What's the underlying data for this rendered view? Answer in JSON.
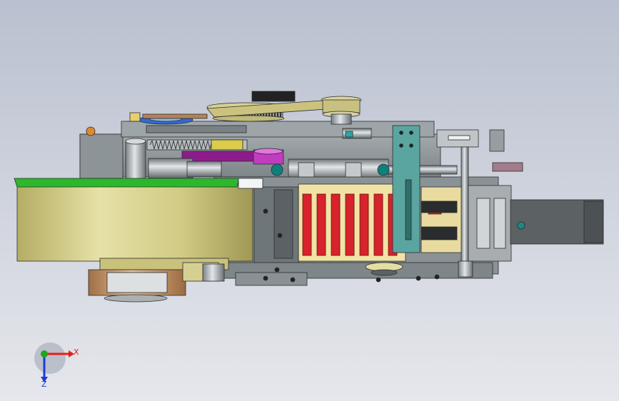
{
  "viewport": {
    "background_top": "#b9c0cf",
    "background_bottom": "#e6e7ec"
  },
  "model": {
    "description_icon": "assembly-model",
    "colors": {
      "housing": "#8e9699",
      "housing_dark": "#4b5256",
      "drum": "#c9c27b",
      "drum_light": "#e6e1a6",
      "drum_top": "#2bb82b",
      "copper": "#c29668",
      "red_slots": "#d7232b",
      "teal_plate": "#5aa5a0",
      "magenta_bar": "#b21fa8",
      "motor": "#5c6163",
      "cream_block": "#f1e3a5"
    }
  },
  "triad": {
    "x_label": "X",
    "z_label": "Z",
    "x_color": "#e0201c",
    "y_color": "#1fa51f",
    "z_color": "#1d3ad8"
  }
}
